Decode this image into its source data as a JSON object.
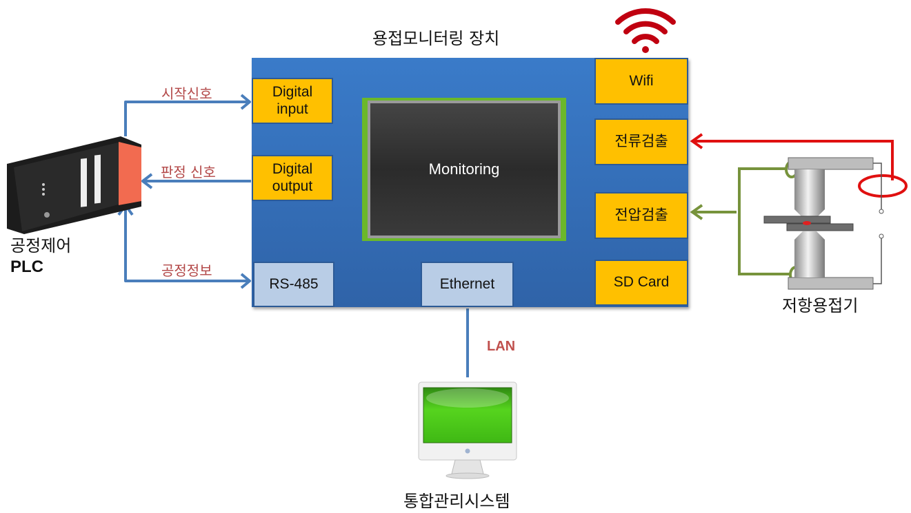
{
  "device": {
    "title": "용접모니터링 장치",
    "screen_label": "Monitoring",
    "left_modules": [
      {
        "label": "Digital input"
      },
      {
        "label": "Digital output"
      },
      {
        "label": "RS-485"
      }
    ],
    "bottom_module": {
      "label": "Ethernet"
    },
    "right_modules": [
      {
        "label": "Wifi"
      },
      {
        "label": "전류검출"
      },
      {
        "label": "전압검출"
      },
      {
        "label": "SD Card"
      }
    ]
  },
  "plc": {
    "label_line1": "공정제어",
    "label_line2": "PLC"
  },
  "signals": {
    "start": "시작신호",
    "judgement": "판정 신호",
    "process_info": "공정정보",
    "lan": "LAN"
  },
  "welder": {
    "label": "저항용접기"
  },
  "management": {
    "label": "통합관리시스템"
  },
  "colors": {
    "device_blue": "#3a7bc9",
    "module_yellow": "#ffc000",
    "module_lightblue": "#b9cde6",
    "connector_blue": "#4a7ebb",
    "current_red": "#e01010",
    "voltage_green": "#77933c",
    "wifi_red": "#c00000",
    "signal_text": "#b24646"
  }
}
